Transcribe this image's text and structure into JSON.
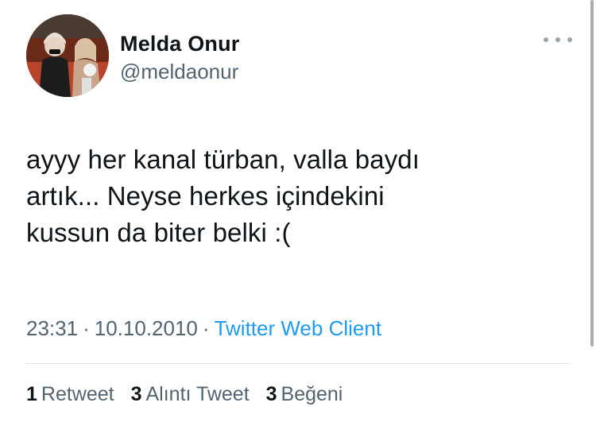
{
  "user": {
    "name": "Melda Onur",
    "handle": "@meldaonur"
  },
  "tweet": {
    "lines": [
      "ayyy her kanal türban, valla baydı",
      "artık... Neyse herkes içindekini",
      "kussun da biter belki :("
    ],
    "time": "23:31",
    "date": "10.10.2010",
    "separator": "·",
    "client": "Twitter Web Client"
  },
  "stats": {
    "retweets": {
      "count": "1",
      "label": "Retweet"
    },
    "quotes": {
      "count": "3",
      "label": "Alıntı Tweet"
    },
    "likes": {
      "count": "3",
      "label": "Beğeni"
    }
  },
  "icons": {
    "more": "more-options-icon",
    "avatar": "profile-photo"
  },
  "colors": {
    "link": "#1d9bf0",
    "secondary_text": "#536471",
    "primary_text": "#0f1419"
  }
}
